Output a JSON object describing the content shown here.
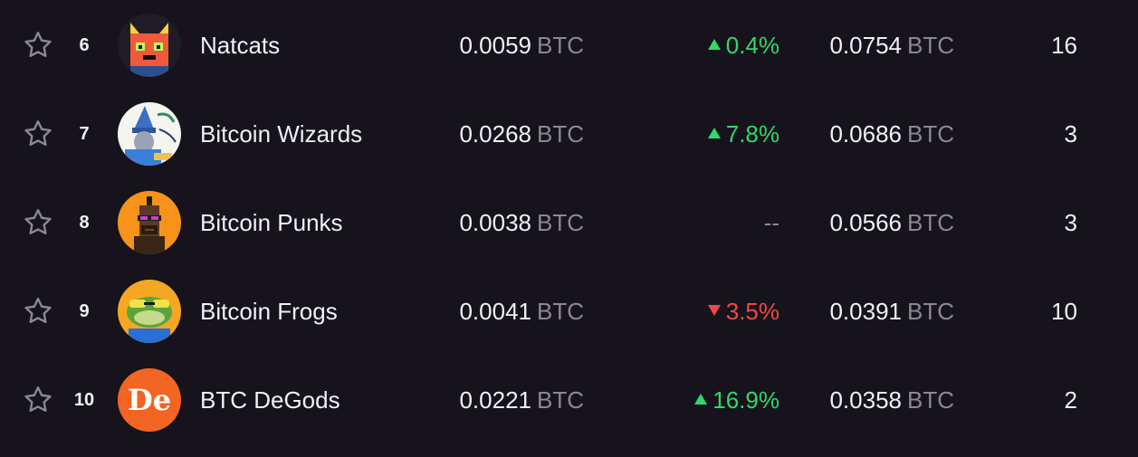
{
  "colors": {
    "background": "#16131c",
    "text": "#f2f0f5",
    "muted": "#8b8794",
    "up": "#2fd96b",
    "down": "#f04848"
  },
  "rows": [
    {
      "rank": "6",
      "name": "Natcats",
      "avatar_icon": "natcat-avatar-icon",
      "price": "0.0059",
      "price_unit": "BTC",
      "change": "0.4%",
      "change_direction": "up",
      "volume": "0.0754",
      "volume_unit": "BTC",
      "count": "16"
    },
    {
      "rank": "7",
      "name": "Bitcoin Wizards",
      "avatar_icon": "bitcoin-wizard-avatar-icon",
      "price": "0.0268",
      "price_unit": "BTC",
      "change": "7.8%",
      "change_direction": "up",
      "volume": "0.0686",
      "volume_unit": "BTC",
      "count": "3"
    },
    {
      "rank": "8",
      "name": "Bitcoin Punks",
      "avatar_icon": "bitcoin-punk-avatar-icon",
      "price": "0.0038",
      "price_unit": "BTC",
      "change": "--",
      "change_direction": "none",
      "volume": "0.0566",
      "volume_unit": "BTC",
      "count": "3"
    },
    {
      "rank": "9",
      "name": "Bitcoin Frogs",
      "avatar_icon": "bitcoin-frog-avatar-icon",
      "price": "0.0041",
      "price_unit": "BTC",
      "change": "3.5%",
      "change_direction": "down",
      "volume": "0.0391",
      "volume_unit": "BTC",
      "count": "10"
    },
    {
      "rank": "10",
      "name": "BTC DeGods",
      "avatar_icon": "btc-degods-avatar-icon",
      "avatar_text": "De",
      "price": "0.0221",
      "price_unit": "BTC",
      "change": "16.9%",
      "change_direction": "up",
      "volume": "0.0358",
      "volume_unit": "BTC",
      "count": "2"
    }
  ]
}
